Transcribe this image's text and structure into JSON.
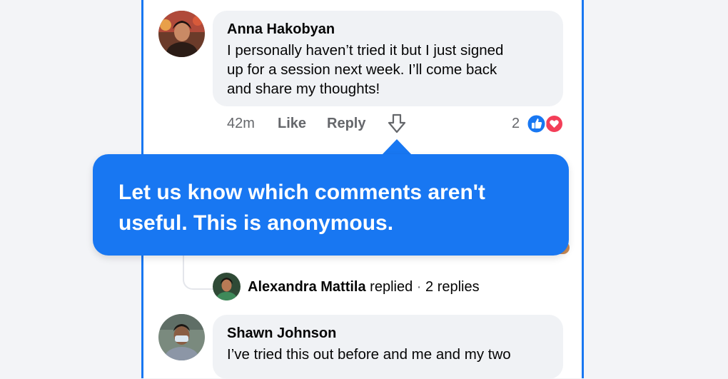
{
  "comments": [
    {
      "author": "Anna Hakobyan",
      "text_lines": [
        "I personally haven’t tried it but I just signed",
        "up for a session next week. I’ll come back",
        "and share my thoughts!"
      ],
      "time": "42m",
      "like_label": "Like",
      "reply_label": "Reply",
      "reaction_count": "2"
    },
    {
      "author": "Shawn Johnson",
      "text_lines": [
        "I’ve tried this out before and me and my two"
      ]
    }
  ],
  "reply_summary": {
    "author": "Alexandra Mattila",
    "action": "replied",
    "separator": "·",
    "count": "2 replies"
  },
  "tooltip": {
    "line1": "Let us know which comments aren't",
    "line2": "useful. This is anonymous."
  },
  "colors": {
    "accent": "#1877f2",
    "like": "#1877f2",
    "love": "#f33e58",
    "bubble": "#f0f2f5",
    "muted": "#65676b"
  },
  "icons": [
    "downvote-arrow-icon",
    "like-reaction-icon",
    "love-reaction-icon"
  ]
}
